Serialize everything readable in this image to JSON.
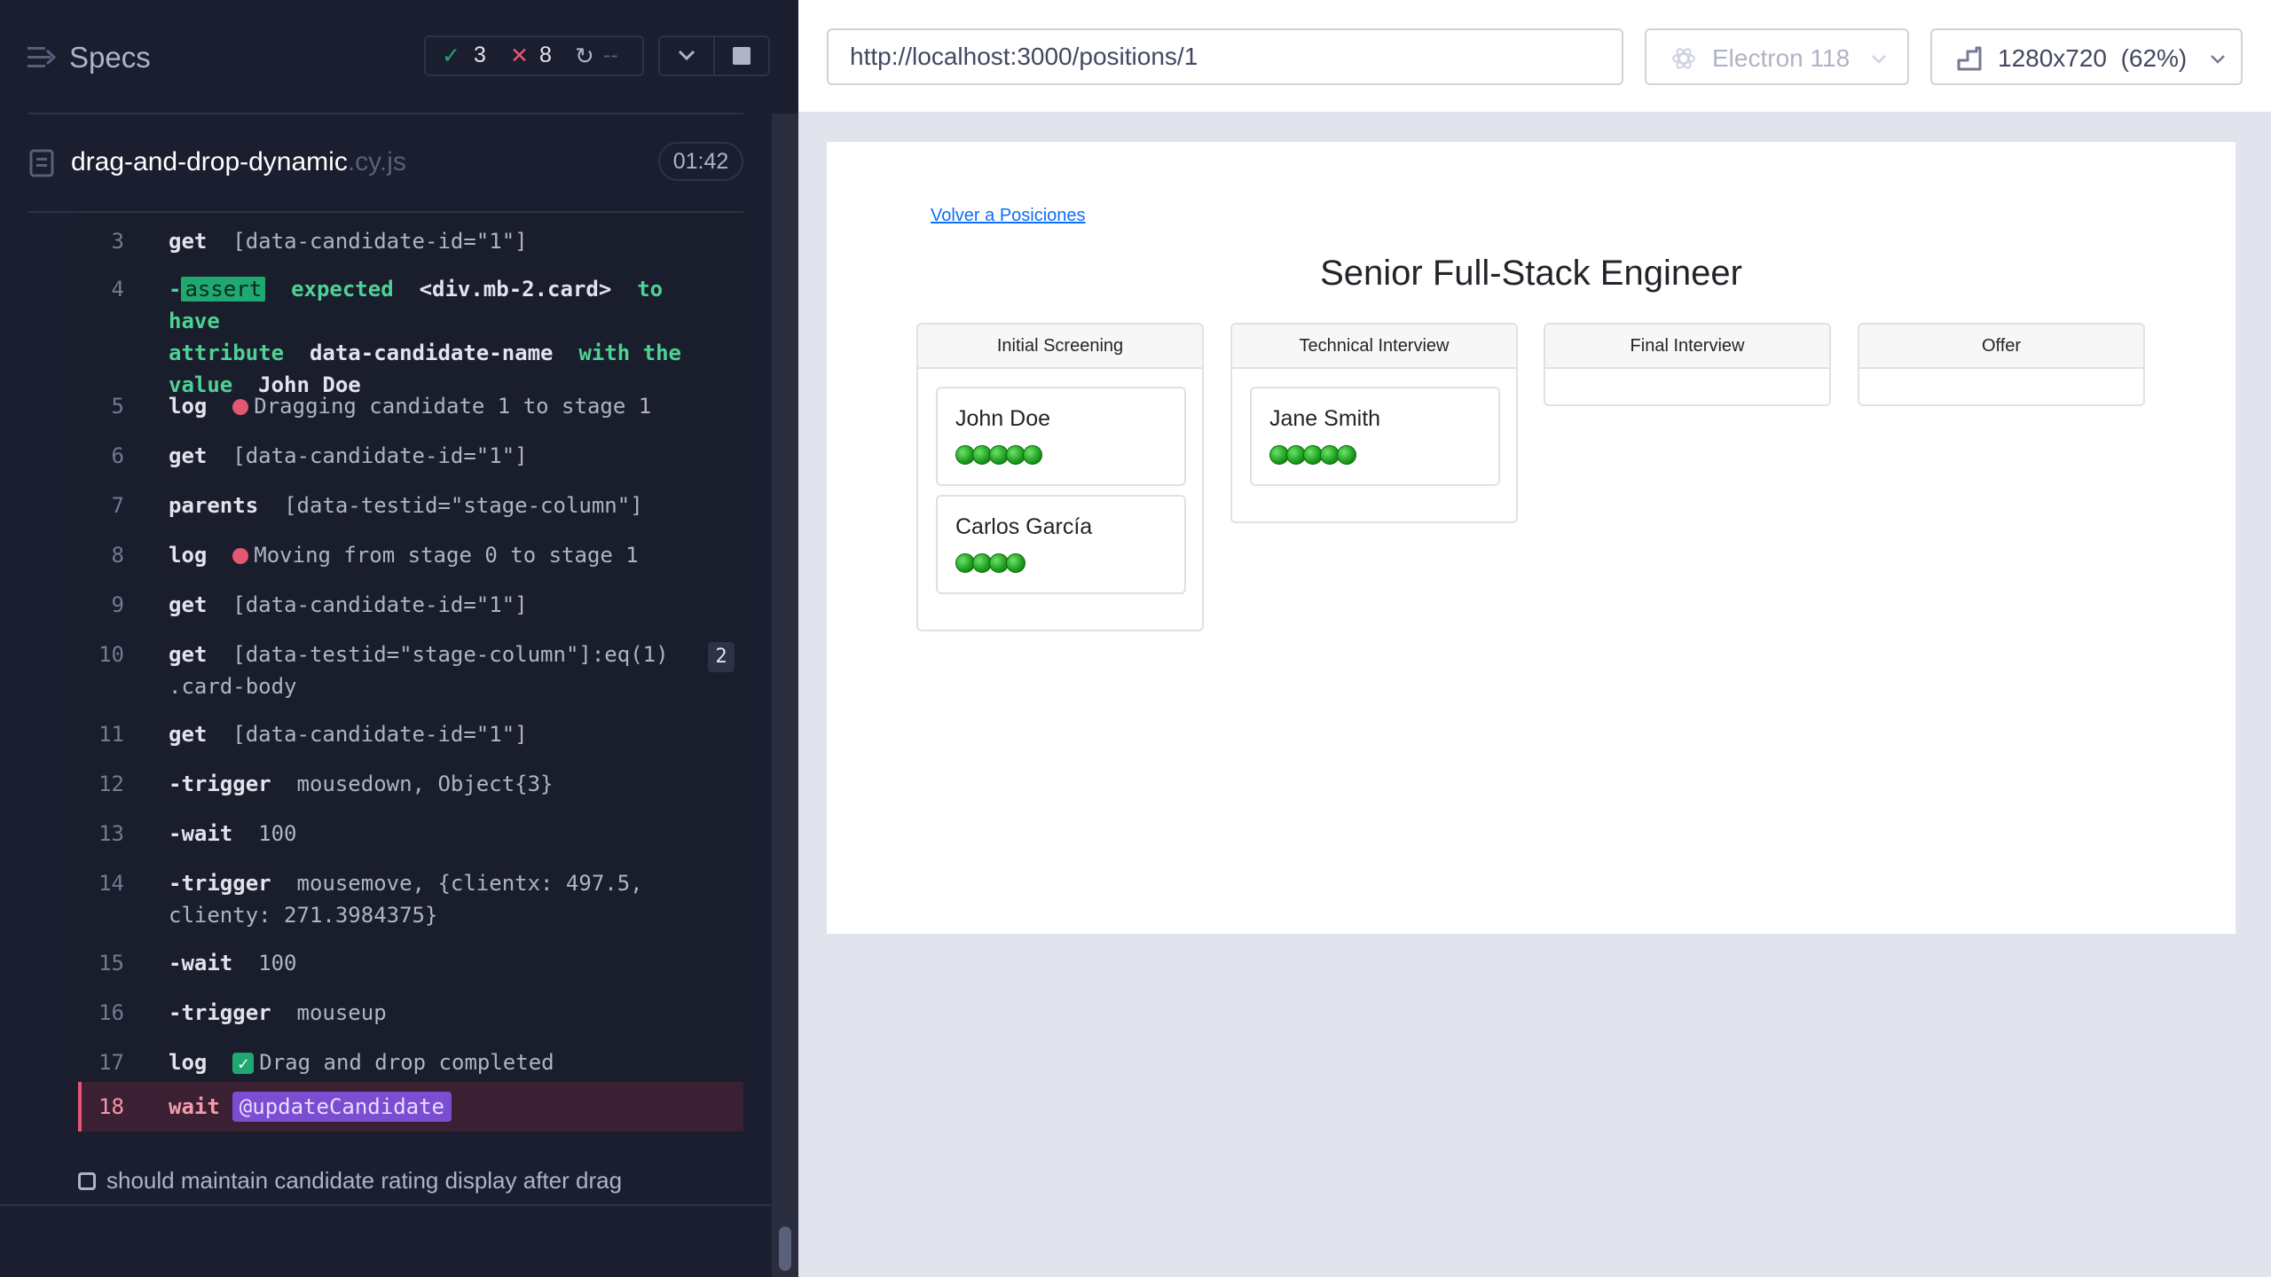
{
  "runner": {
    "title": "Specs",
    "stats": {
      "passed": "3",
      "failed": "8",
      "pending": "--"
    },
    "spec": {
      "name": "drag-and-drop-dynamic",
      "ext": ".cy.js",
      "duration": "01:42"
    },
    "commands": [
      {
        "num": "3",
        "name": "get",
        "message": "[data-candidate-id=\"1\"]"
      },
      {
        "num": "4",
        "assert_badge": "assert",
        "assert_expected": "expected",
        "assert_el": "<div.mb-2.card>",
        "assert_to_have": "to have",
        "assert_attribute": "attribute",
        "assert_attr_name": "data-candidate-name",
        "assert_with": "with the",
        "assert_value_word": "value",
        "assert_value": "John Doe"
      },
      {
        "num": "5",
        "name": "log",
        "message": "Dragging candidate 1 to stage 1"
      },
      {
        "num": "6",
        "name": "get",
        "message": "[data-candidate-id=\"1\"]"
      },
      {
        "num": "7",
        "name": "parents",
        "message": "[data-testid=\"stage-column\"]"
      },
      {
        "num": "8",
        "name": "log",
        "message": "Moving from stage 0 to stage 1"
      },
      {
        "num": "9",
        "name": "get",
        "message": "[data-candidate-id=\"1\"]"
      },
      {
        "num": "10",
        "name": "get",
        "message": "[data-testid=\"stage-column\"]:eq(1)",
        "message2": ".card-body",
        "count": "2"
      },
      {
        "num": "11",
        "name": "get",
        "message": "[data-candidate-id=\"1\"]"
      },
      {
        "num": "12",
        "name": "-trigger",
        "message": "mousedown, Object{3}"
      },
      {
        "num": "13",
        "name": "-wait",
        "message": "100"
      },
      {
        "num": "14",
        "name": "-trigger",
        "message": "mousemove, {clientx: 497.5,",
        "message2": "clienty: 271.3984375}"
      },
      {
        "num": "15",
        "name": "-wait",
        "message": "100"
      },
      {
        "num": "16",
        "name": "-trigger",
        "message": "mouseup"
      },
      {
        "num": "17",
        "name": "log",
        "message": "Drag and drop completed"
      },
      {
        "num": "18",
        "name": "wait",
        "message": "@updateCandidate"
      }
    ],
    "next_test": "should maintain candidate rating display after drag"
  },
  "browser_bar": {
    "url": "http://localhost:3000/positions/1",
    "browser": "Electron 118",
    "viewport": "1280x720  (62%)"
  },
  "app": {
    "back_link": "Volver a Posiciones",
    "position_title": "Senior Full-Stack Engineer",
    "stages": [
      {
        "name": "Initial Screening",
        "candidates": [
          {
            "name": "John Doe",
            "rating": 5
          },
          {
            "name": "Carlos García",
            "rating": 4
          }
        ]
      },
      {
        "name": "Technical Interview",
        "candidates": [
          {
            "name": "Jane Smith",
            "rating": 5
          }
        ]
      },
      {
        "name": "Final Interview",
        "candidates": []
      },
      {
        "name": "Offer",
        "candidates": []
      }
    ]
  },
  "colors": {
    "pass": "#1fa971",
    "fail": "#e45770",
    "alias": "#7a4dd2",
    "link": "#0d6efd",
    "rating": "#1c9a1c"
  }
}
